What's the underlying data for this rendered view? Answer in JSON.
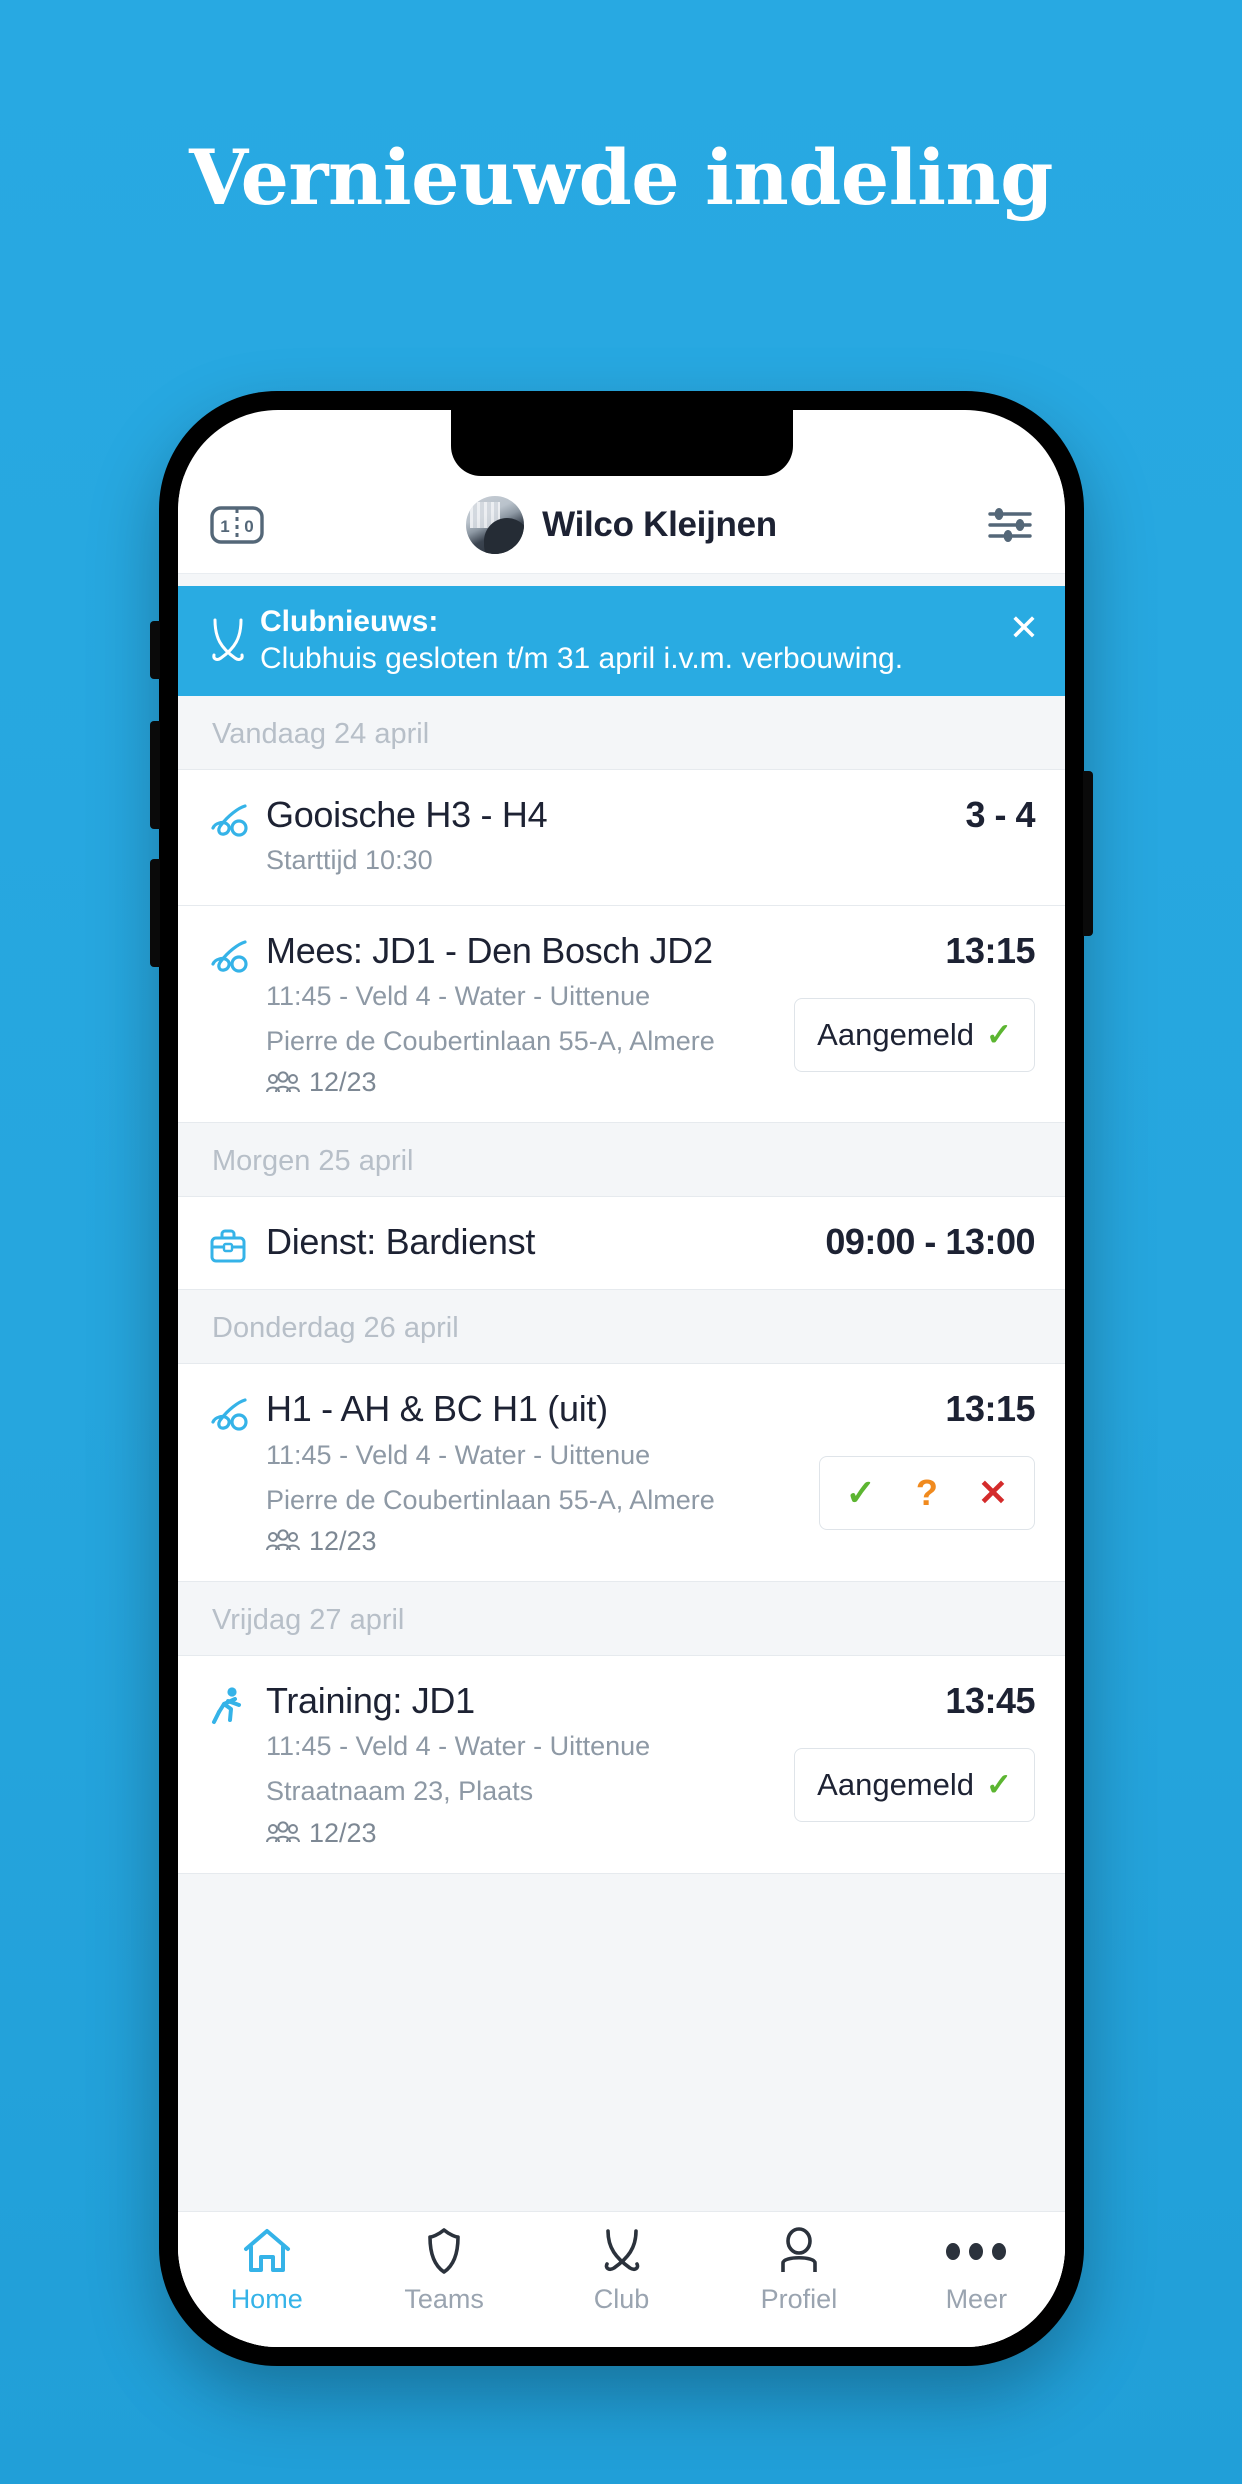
{
  "headline": "Vernieuwde indeling",
  "header": {
    "scoreboard_icon": "scoreboard-icon",
    "score_left": "1",
    "score_right": "0",
    "user_name": "Wilco Kleijnen",
    "avatar_icon": "user-avatar",
    "settings_icon": "sliders-icon"
  },
  "banner": {
    "icon": "crossed-hockey-sticks-icon",
    "title": "Clubnieuws:",
    "message": "Clubhuis gesloten t/m 31 april i.v.m. verbouwing.",
    "close_label": "✕",
    "color": "#29ABE2"
  },
  "sections": [
    {
      "day_label": "Vandaag 24 april",
      "events": [
        {
          "icon": "hockey-stick-ball-icon",
          "title": "Gooische H3 - H4",
          "sub1": "Starttijd 10:30",
          "sub2": "",
          "attendance": "",
          "time": "3 - 4",
          "action": "none"
        },
        {
          "icon": "hockey-stick-ball-icon",
          "title": "Mees: JD1 - Den Bosch JD2",
          "sub1": "11:45 - Veld 4 - Water - Uittenue",
          "sub2": "Pierre de Coubertinlaan 55-A, Almere",
          "attendance": "12/23",
          "time": "13:15",
          "action": "aangemeld",
          "action_label": "Aangemeld"
        }
      ]
    },
    {
      "day_label": "Morgen 25 april",
      "events": [
        {
          "icon": "briefcase-icon",
          "title": "Dienst: Bardienst",
          "sub1": "",
          "sub2": "",
          "attendance": "",
          "time": "09:00 - 13:00",
          "action": "none"
        }
      ]
    },
    {
      "day_label": "Donderdag 26 april",
      "events": [
        {
          "icon": "hockey-stick-ball-icon",
          "title": "H1 - AH & BC H1 (uit)",
          "sub1": "11:45 - Veld 4 - Water - Uittenue",
          "sub2": "Pierre de Coubertinlaan 55-A, Almere",
          "attendance": "12/23",
          "time": "13:15",
          "action": "choice",
          "choice_yes": "✓",
          "choice_maybe": "?",
          "choice_no": "✕"
        }
      ]
    },
    {
      "day_label": "Vrijdag 27 april",
      "events": [
        {
          "icon": "running-person-icon",
          "title": "Training: JD1",
          "sub1": "11:45 - Veld 4 - Water - Uittenue",
          "sub2": "Straatnaam 23, Plaats",
          "attendance": "12/23",
          "time": "13:45",
          "action": "aangemeld",
          "action_label": "Aangemeld"
        }
      ]
    }
  ],
  "tabbar": {
    "items": [
      {
        "label": "Home",
        "icon": "home-icon",
        "active": true
      },
      {
        "label": "Teams",
        "icon": "shield-icon",
        "active": false
      },
      {
        "label": "Club",
        "icon": "crossed-sticks-icon",
        "active": false
      },
      {
        "label": "Profiel",
        "icon": "person-icon",
        "active": false
      },
      {
        "label": "Meer",
        "icon": "ellipsis-icon",
        "active": false
      }
    ]
  },
  "colors": {
    "background": "#26a6de",
    "accent": "#29ABE2",
    "text_dark": "#1d2233",
    "text_muted": "#8e99a5",
    "green": "#5cb531",
    "orange": "#f08a1e",
    "red": "#d42b2b"
  }
}
